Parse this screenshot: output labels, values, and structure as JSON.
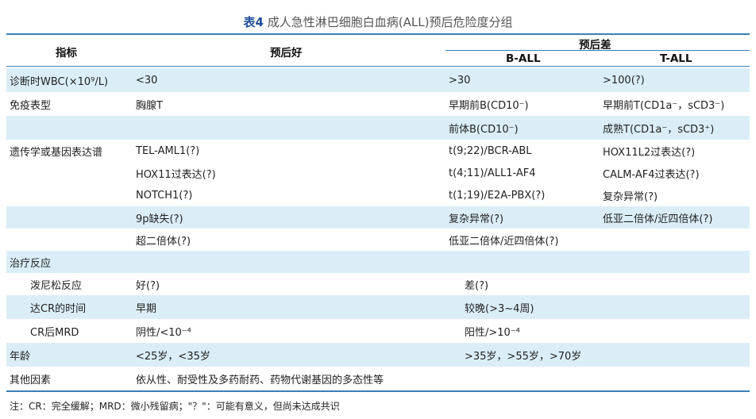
{
  "title": {
    "prefix": "表4",
    "text": "成人急性淋巴细胞白血病(ALL)预后危险度分组"
  },
  "header": {
    "col_indicator": "指标",
    "col_good": "预后好",
    "col_poor": "预后差",
    "sub_ball": "B-ALL",
    "sub_tall": "T-ALL"
  },
  "rows": [
    {
      "indicator": "诊断时WBC(×10⁹/L)",
      "good": "<30",
      "ball": ">30",
      "tall": ">100(?)",
      "shade": true
    },
    {
      "indicator": "免疫表型",
      "good": "胸腺T",
      "ball": "早期前B(CD10⁻)",
      "tall": "早期前T(CD1a⁻，sCD3⁻)",
      "shade": false
    },
    {
      "indicator": "",
      "good": "",
      "ball": "前体B(CD10⁻)",
      "tall": "成熟T(CD1a⁻，sCD3⁺)",
      "shade": true
    },
    {
      "indicator": "遗传学或基因表达谱",
      "good": "TEL-AML1(?)",
      "ball": "t(9;22)/BCR-ABL",
      "tall": "HOX11L2过表达(?)",
      "shade": false
    },
    {
      "indicator": "",
      "good": "HOX11过表达(?)",
      "ball": "t(4;11)/ALL1-AF4",
      "tall": "CALM-AF4过表达(?)",
      "shade": false
    },
    {
      "indicator": "",
      "good": "NOTCH1(?)",
      "ball": "t(1;19)/E2A-PBX(?)",
      "tall": "复杂异常(?)",
      "shade": false
    },
    {
      "indicator": "",
      "good": "9p缺失(?)",
      "ball": "复杂异常(?)",
      "tall": "低亚二倍体/近四倍体(?)",
      "shade": true
    },
    {
      "indicator": "",
      "good": "超二倍体(?)",
      "ball": "低亚二倍体/近四倍体(?)",
      "tall": "",
      "shade": false
    },
    {
      "indicator": "治疗反应",
      "good": "",
      "ball": "",
      "tall": "",
      "shade": true
    },
    {
      "indicator": "泼尼松反应",
      "good": "好(?)",
      "ball": "差(?)",
      "tall": "",
      "shade": false,
      "indent": true,
      "shift": true
    },
    {
      "indicator": "达CR的时间",
      "good": "早期",
      "ball": "较晚(>3~4周)",
      "tall": "",
      "shade": true,
      "indent": true,
      "shift": true
    },
    {
      "indicator": "CR后MRD",
      "good": "阴性/<10⁻⁴",
      "ball": "阳性/>10⁻⁴",
      "tall": "",
      "shade": false,
      "indent": true,
      "shift": true
    },
    {
      "indicator": "年龄",
      "good": "<25岁，<35岁",
      "ball": ">35岁，>55岁，>70岁",
      "tall": "",
      "shade": true,
      "shift": true
    },
    {
      "indicator": "其他因素",
      "good": "依从性、耐受性及多药耐药、药物代谢基因的多态性等",
      "ball": "",
      "tall": "",
      "shade": false
    }
  ],
  "note": "注：CR：完全缓解；MRD：微小残留病；\"？\"：可能有意义，但尚未达成共识"
}
